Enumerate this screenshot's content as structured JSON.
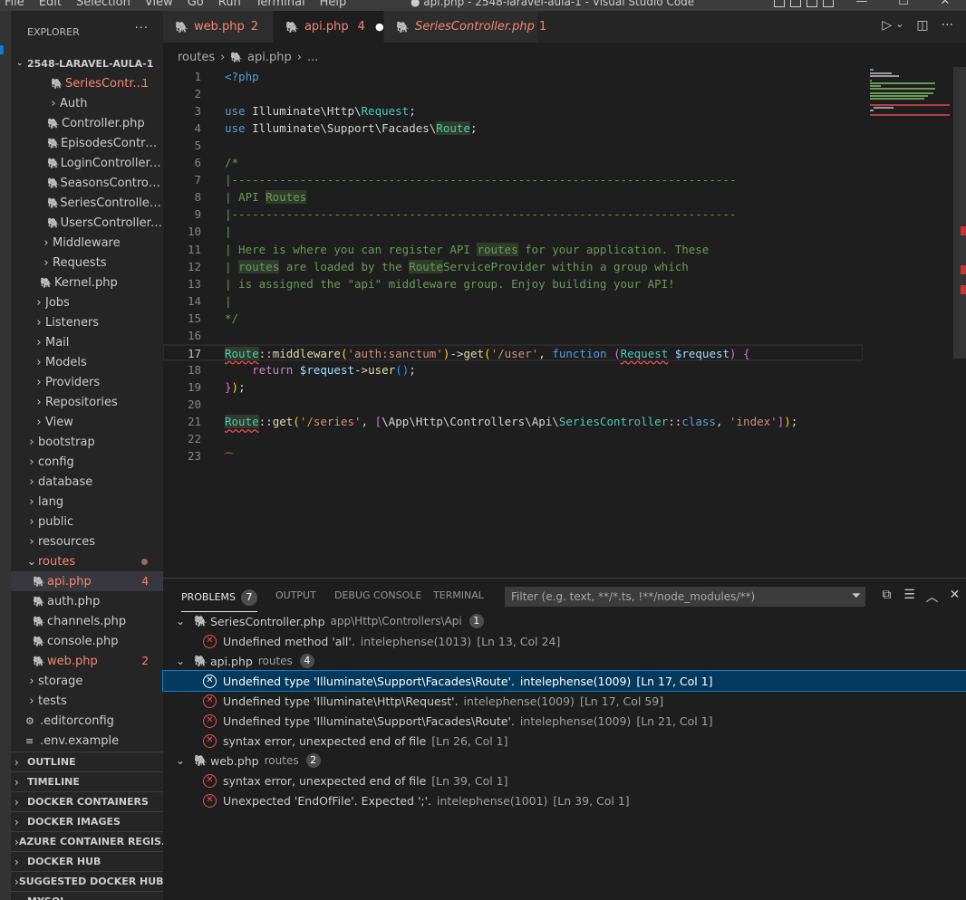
{
  "window": {
    "title": "● api.php - 2548-laravel-aula-1 - Visual Studio Code",
    "menus": [
      "File",
      "Edit",
      "Selection",
      "View",
      "Go",
      "Run",
      "Terminal",
      "Help"
    ],
    "controls": {
      "minimize": "—",
      "maximize": "☐",
      "close": "✕"
    }
  },
  "explorer": {
    "title": "EXPLORER",
    "more": "···",
    "project": "2548-LARAVEL-AULA-1",
    "tree": [
      {
        "label": "SeriesContr...",
        "type": "file",
        "indent": 44,
        "error": true,
        "badge": "1"
      },
      {
        "label": "Auth",
        "type": "folder",
        "indent": 40
      },
      {
        "label": "Controller.php",
        "type": "file",
        "indent": 40
      },
      {
        "label": "EpisodesControll...",
        "type": "file",
        "indent": 40
      },
      {
        "label": "LoginController.p...",
        "type": "file",
        "indent": 40
      },
      {
        "label": "SeasonsControlle...",
        "type": "file",
        "indent": 40
      },
      {
        "label": "SeriesController.p...",
        "type": "file",
        "indent": 40
      },
      {
        "label": "UsersController.p...",
        "type": "file",
        "indent": 40
      },
      {
        "label": "Middleware",
        "type": "folder",
        "indent": 32
      },
      {
        "label": "Requests",
        "type": "folder",
        "indent": 32
      },
      {
        "label": "Kernel.php",
        "type": "file",
        "indent": 32
      },
      {
        "label": "Jobs",
        "type": "folder",
        "indent": 24
      },
      {
        "label": "Listeners",
        "type": "folder",
        "indent": 24
      },
      {
        "label": "Mail",
        "type": "folder",
        "indent": 24
      },
      {
        "label": "Models",
        "type": "folder",
        "indent": 24
      },
      {
        "label": "Providers",
        "type": "folder",
        "indent": 24
      },
      {
        "label": "Repositories",
        "type": "folder",
        "indent": 24
      },
      {
        "label": "View",
        "type": "folder",
        "indent": 24
      },
      {
        "label": "bootstrap",
        "type": "folder",
        "indent": 16
      },
      {
        "label": "config",
        "type": "folder",
        "indent": 16
      },
      {
        "label": "database",
        "type": "folder",
        "indent": 16
      },
      {
        "label": "lang",
        "type": "folder",
        "indent": 16
      },
      {
        "label": "public",
        "type": "folder",
        "indent": 16
      },
      {
        "label": "resources",
        "type": "folder",
        "indent": 16
      },
      {
        "label": "routes",
        "type": "folder-open",
        "indent": 16,
        "error": true,
        "dot": true
      },
      {
        "label": "api.php",
        "type": "file",
        "indent": 24,
        "error": true,
        "badge": "4",
        "selected": true
      },
      {
        "label": "auth.php",
        "type": "file",
        "indent": 24
      },
      {
        "label": "channels.php",
        "type": "file",
        "indent": 24
      },
      {
        "label": "console.php",
        "type": "file",
        "indent": 24
      },
      {
        "label": "web.php",
        "type": "file",
        "indent": 24,
        "error": true,
        "badge": "2"
      },
      {
        "label": "storage",
        "type": "folder",
        "indent": 16
      },
      {
        "label": "tests",
        "type": "folder",
        "indent": 16
      },
      {
        "label": ".editorconfig",
        "type": "gear",
        "indent": 16
      },
      {
        "label": ".env.example",
        "type": "lines",
        "indent": 16
      }
    ],
    "sections": [
      "OUTLINE",
      "TIMELINE",
      "DOCKER CONTAINERS",
      "DOCKER IMAGES",
      "AZURE CONTAINER REGIS...",
      "DOCKER HUB",
      "SUGGESTED DOCKER HUB ...",
      "MYSQL"
    ]
  },
  "tabs": [
    {
      "label": "web.php",
      "badge": "2",
      "active": false,
      "italic": false
    },
    {
      "label": "api.php",
      "badge": "4",
      "active": true,
      "modified": true,
      "italic": false
    },
    {
      "label": "SeriesController.php",
      "badge": "1",
      "active": false,
      "italic": true
    }
  ],
  "editor_actions": {
    "run": "▷",
    "run_menu": "⌄",
    "split": "◫",
    "more": "···"
  },
  "breadcrumb": {
    "folder": "routes",
    "file": "api.php",
    "rest": "..."
  },
  "code": {
    "current_line": 17,
    "lines": [
      [
        {
          "t": "<?php",
          "c": "kw"
        }
      ],
      [],
      [
        {
          "t": "use",
          "c": "kw"
        },
        {
          "t": " Illuminate\\Http\\",
          "c": "txt"
        },
        {
          "t": "Request",
          "c": "cls"
        },
        {
          "t": ";",
          "c": "txt"
        }
      ],
      [
        {
          "t": "use",
          "c": "kw"
        },
        {
          "t": " Illuminate\\Support\\Facades\\",
          "c": "txt"
        },
        {
          "t": "Route",
          "c": "cls hl"
        },
        {
          "t": ";",
          "c": "txt"
        }
      ],
      [],
      [
        {
          "t": "/*",
          "c": "cm"
        }
      ],
      [
        {
          "t": "|--------------------------------------------------------------------------",
          "c": "cm"
        }
      ],
      [
        {
          "t": "| API ",
          "c": "cm"
        },
        {
          "t": "Routes",
          "c": "cm hl"
        }
      ],
      [
        {
          "t": "|--------------------------------------------------------------------------",
          "c": "cm"
        }
      ],
      [
        {
          "t": "|",
          "c": "cm"
        }
      ],
      [
        {
          "t": "| Here is where you can register API ",
          "c": "cm"
        },
        {
          "t": "routes",
          "c": "cm hl"
        },
        {
          "t": " for your application. These",
          "c": "cm"
        }
      ],
      [
        {
          "t": "| ",
          "c": "cm"
        },
        {
          "t": "routes",
          "c": "cm hl"
        },
        {
          "t": " are loaded by the ",
          "c": "cm"
        },
        {
          "t": "Route",
          "c": "cm hl"
        },
        {
          "t": "ServiceProvider within a group which",
          "c": "cm"
        }
      ],
      [
        {
          "t": "| is assigned the \"api\" middleware group. Enjoy building your API!",
          "c": "cm"
        }
      ],
      [
        {
          "t": "|",
          "c": "cm"
        }
      ],
      [
        {
          "t": "*/",
          "c": "cm"
        }
      ],
      [],
      [
        {
          "t": "Route",
          "c": "cls squig hl"
        },
        {
          "t": "::",
          "c": "txt"
        },
        {
          "t": "middleware",
          "c": "fn"
        },
        {
          "t": "(",
          "c": "br1"
        },
        {
          "t": "'auth:sanctum'",
          "c": "str"
        },
        {
          "t": ")",
          "c": "br1"
        },
        {
          "t": "->",
          "c": "txt"
        },
        {
          "t": "get",
          "c": "fn"
        },
        {
          "t": "(",
          "c": "br1"
        },
        {
          "t": "'/user'",
          "c": "str"
        },
        {
          "t": ", ",
          "c": "txt"
        },
        {
          "t": "function",
          "c": "kw"
        },
        {
          "t": " ",
          "c": "txt"
        },
        {
          "t": "(",
          "c": "br2"
        },
        {
          "t": "Request",
          "c": "cls squig"
        },
        {
          "t": " ",
          "c": "txt"
        },
        {
          "t": "$request",
          "c": "var"
        },
        {
          "t": ")",
          "c": "br2"
        },
        {
          "t": " ",
          "c": "txt"
        },
        {
          "t": "{",
          "c": "br2"
        }
      ],
      [
        {
          "t": "    ",
          "c": "txt"
        },
        {
          "t": "return",
          "c": "kw2"
        },
        {
          "t": " ",
          "c": "txt"
        },
        {
          "t": "$request",
          "c": "var"
        },
        {
          "t": "->",
          "c": "txt"
        },
        {
          "t": "user",
          "c": "fn"
        },
        {
          "t": "()",
          "c": "br3"
        },
        {
          "t": ";",
          "c": "txt"
        }
      ],
      [
        {
          "t": "}",
          "c": "br2"
        },
        {
          "t": ")",
          "c": "br1"
        },
        {
          "t": ";",
          "c": "txt"
        }
      ],
      [],
      [
        {
          "t": "Route",
          "c": "cls squig hl"
        },
        {
          "t": "::",
          "c": "txt"
        },
        {
          "t": "get",
          "c": "fn"
        },
        {
          "t": "(",
          "c": "br1"
        },
        {
          "t": "'/series'",
          "c": "str"
        },
        {
          "t": ", ",
          "c": "txt"
        },
        {
          "t": "[",
          "c": "br2"
        },
        {
          "t": "\\App\\Http\\Controllers\\Api\\",
          "c": "txt"
        },
        {
          "t": "SeriesController",
          "c": "cls"
        },
        {
          "t": "::",
          "c": "txt"
        },
        {
          "t": "class",
          "c": "kw"
        },
        {
          "t": ", ",
          "c": "txt"
        },
        {
          "t": "'index'",
          "c": "str"
        },
        {
          "t": "]",
          "c": "br2"
        },
        {
          "t": ")",
          "c": "br1"
        },
        {
          "t": ";",
          "c": "txt"
        }
      ],
      [],
      []
    ]
  },
  "panel": {
    "tabs": [
      {
        "label": "PROBLEMS",
        "count": "7",
        "active": true
      },
      {
        "label": "OUTPUT"
      },
      {
        "label": "DEBUG CONSOLE"
      },
      {
        "label": "TERMINAL"
      }
    ],
    "filter_placeholder": "Filter (e.g. text, **/*.ts, !**/node_modules/**)",
    "actions": {
      "filter": "⏷",
      "copy": "⧉",
      "collapse": "☰",
      "maximize": "︿",
      "close": "✕"
    },
    "groups": [
      {
        "file": "SeriesController.php",
        "path": "app\\Http\\Controllers\\Api",
        "count": "1",
        "items": [
          {
            "msg": "Undefined method 'all'.",
            "src": "intelephense(1013)",
            "loc": "[Ln 13, Col 24]"
          }
        ]
      },
      {
        "file": "api.php",
        "path": "routes",
        "count": "4",
        "items": [
          {
            "msg": "Undefined type 'Illuminate\\Support\\Facades\\Route'.",
            "src": "intelephense(1009)",
            "loc": "[Ln 17, Col 1]",
            "selected": true
          },
          {
            "msg": "Undefined type 'Illuminate\\Http\\Request'.",
            "src": "intelephense(1009)",
            "loc": "[Ln 17, Col 59]"
          },
          {
            "msg": "Undefined type 'Illuminate\\Support\\Facades\\Route'.",
            "src": "intelephense(1009)",
            "loc": "[Ln 21, Col 1]"
          },
          {
            "msg": "syntax error, unexpected end of file",
            "src": "",
            "loc": "[Ln 26, Col 1]"
          }
        ]
      },
      {
        "file": "web.php",
        "path": "routes",
        "count": "2",
        "items": [
          {
            "msg": "syntax error, unexpected end of file",
            "src": "",
            "loc": "[Ln 39, Col 1]"
          },
          {
            "msg": "Unexpected 'EndOfFile'. Expected ';'.",
            "src": "intelephense(1001)",
            "loc": "[Ln 39, Col 1]"
          }
        ]
      }
    ]
  },
  "colors": {
    "error": "#f48771",
    "accent": "#007fd4",
    "php": "#a074c4"
  }
}
